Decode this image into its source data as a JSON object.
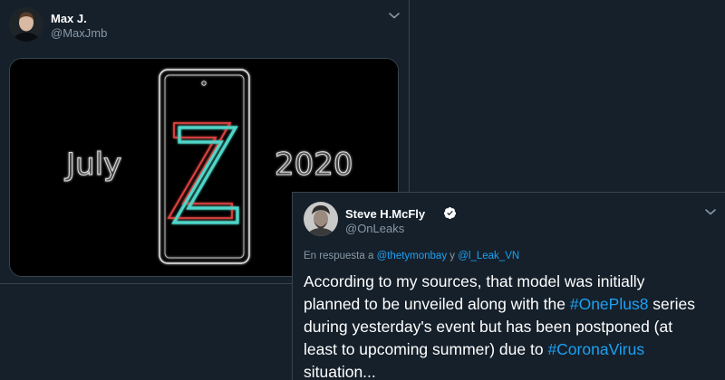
{
  "tweet1": {
    "name": "Max J.",
    "handle": "@MaxJmb",
    "image": {
      "left_text": "July",
      "center_letter": "Z",
      "right_text": "2020"
    }
  },
  "tweet2": {
    "name": "Steve H.McFly",
    "handle": "@OnLeaks",
    "verified": true,
    "reply": {
      "prefix": "En respuesta a",
      "mention1": "@thetymonbay",
      "joiner": "y",
      "mention2": "@l_Leak_VN"
    },
    "body": {
      "line1": "According to my sources, that model was initially",
      "line2_pre": "planned to be unveiled along with the ",
      "hashtag1": "#OnePlus8",
      "line2_post": " series",
      "line3": "during yesterday's event but has been postponed (at",
      "line4_pre": "least to upcoming summer) due to ",
      "hashtag2": "#CoronaVirus",
      "line5": "situation..."
    }
  },
  "colors": {
    "background": "#15202b",
    "border": "#38444d",
    "secondary_text": "#8899a6",
    "link": "#1da1f2",
    "neon_red": "#e0433f",
    "neon_teal": "#4fd6c8"
  },
  "icons": {
    "caret": "chevron-down-icon",
    "verified": "verified-badge-icon"
  }
}
